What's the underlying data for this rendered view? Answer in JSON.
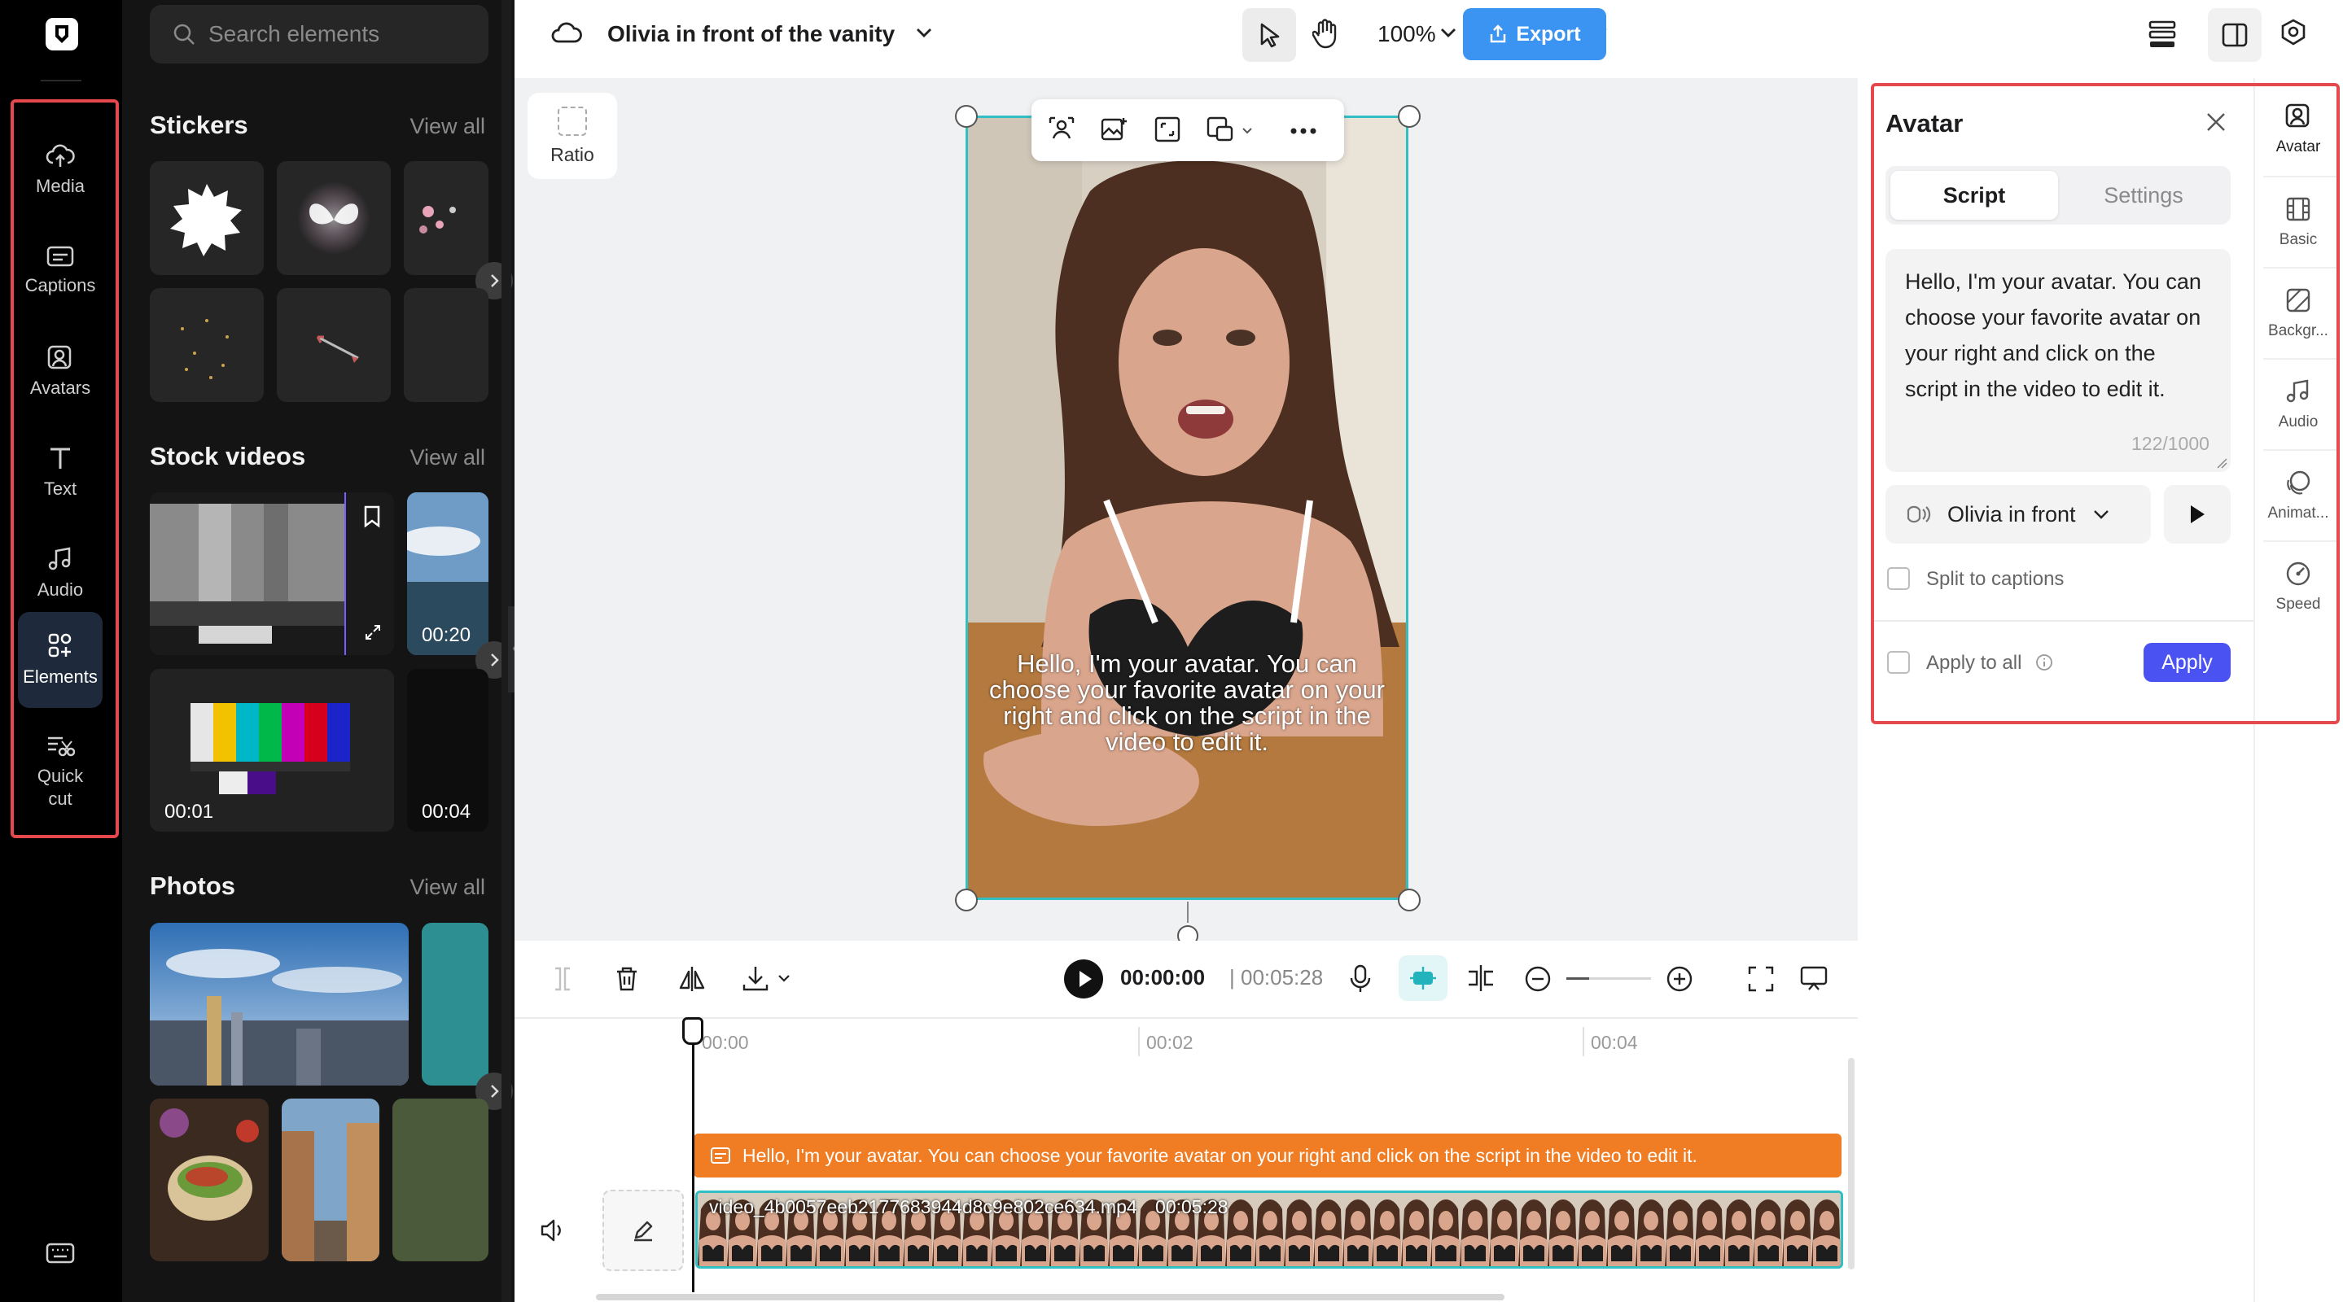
{
  "left_rail": {
    "items": [
      {
        "label": "Media",
        "icon": "cloud-upload-icon"
      },
      {
        "label": "Captions",
        "icon": "captions-icon"
      },
      {
        "label": "Avatars",
        "icon": "avatar-icon"
      },
      {
        "label": "Text",
        "icon": "text-icon"
      },
      {
        "label": "Audio",
        "icon": "music-note-icon"
      },
      {
        "label": "Elements",
        "icon": "elements-icon"
      },
      {
        "label": "Quick cut",
        "icon": "quick-cut-icon"
      }
    ],
    "active": "Elements"
  },
  "left_panel": {
    "search_placeholder": "Search elements",
    "sections": {
      "stickers": {
        "title": "Stickers",
        "view_all": "View all"
      },
      "stock_videos": {
        "title": "Stock videos",
        "view_all": "View all",
        "durations": [
          "00:20",
          "00:01",
          "00:04"
        ]
      },
      "photos": {
        "title": "Photos",
        "view_all": "View all"
      }
    }
  },
  "topbar": {
    "project_title": "Olivia in front of the vanity",
    "zoom": "100%",
    "export_label": "Export"
  },
  "canvas": {
    "ratio_label": "Ratio",
    "overlay_caption": "Hello, I'm your avatar. You can choose your favorite avatar on your right and click on the script in the video to edit it."
  },
  "timeline": {
    "current_time": "00:00:00",
    "total_time": "| 00:05:28",
    "ruler": [
      "00:00",
      "00:02",
      "00:04"
    ],
    "caption_track_text": "Hello, I'm your avatar. You can choose your favorite avatar on your right and click on the script in the video to edit it.",
    "video_clip_name": "video_4b0057eeb2177683944d8c9e802ce634.mp4",
    "video_clip_duration": "00:05:28"
  },
  "avatar_panel": {
    "title": "Avatar",
    "tabs": [
      "Script",
      "Settings"
    ],
    "active_tab": "Script",
    "script_text": "Hello, I'm your avatar. You can choose your favorite avatar on your right and click on the script in the video to edit it.",
    "char_count": "122/1000",
    "voice_name": "Olivia in front",
    "split_to_captions": "Split to captions",
    "apply_to_all": "Apply to all",
    "apply_label": "Apply"
  },
  "right_tabs": {
    "items": [
      {
        "label": "Avatar",
        "icon": "avatar-icon"
      },
      {
        "label": "Basic",
        "icon": "film-icon"
      },
      {
        "label": "Backgr...",
        "icon": "background-icon"
      },
      {
        "label": "Audio",
        "icon": "music-note-icon"
      },
      {
        "label": "Animat...",
        "icon": "animation-icon"
      },
      {
        "label": "Speed",
        "icon": "speed-icon"
      }
    ],
    "active": "Avatar"
  },
  "colors": {
    "accent": "#3b93f2",
    "apply": "#4a53f2",
    "caption_track": "#f07c23",
    "selection": "#2fbfc5",
    "highlight_box": "#e5484d"
  }
}
